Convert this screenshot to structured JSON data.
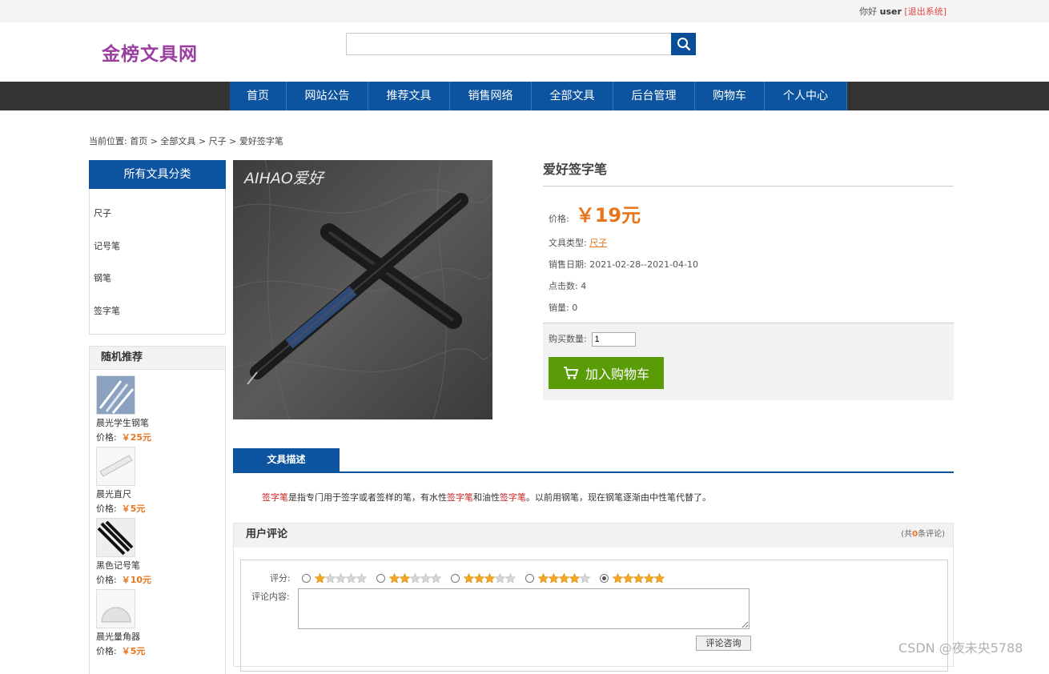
{
  "topbar": {
    "greeting": "你好",
    "username": "user",
    "logout": "[退出系统]"
  },
  "header": {
    "logo": "金榜文具网",
    "search_placeholder": ""
  },
  "nav": [
    "首页",
    "网站公告",
    "推荐文具",
    "销售网络",
    "全部文具",
    "后台管理",
    "购物车",
    "个人中心"
  ],
  "breadcrumb": "当前位置: 首页 > 全部文具 > 尺子 > 爱好签字笔",
  "sidebar": {
    "category_title": "所有文具分类",
    "categories": [
      "尺子",
      "记号笔",
      "钢笔",
      "签字笔"
    ],
    "recommend_title": "随机推荐",
    "recommendations": [
      {
        "name": "晨光学生钢笔",
        "price_label": "价格:",
        "price": "￥25元"
      },
      {
        "name": "晨光直尺",
        "price_label": "价格:",
        "price": "￥5元"
      },
      {
        "name": "黑色记号笔",
        "price_label": "价格:",
        "price": "￥10元"
      },
      {
        "name": "晨光量角器",
        "price_label": "价格:",
        "price": "￥5元"
      }
    ]
  },
  "product": {
    "image_brand": "AIHAO爱好",
    "title": "爱好签字笔",
    "price_label": "价格:",
    "price": "￥19元",
    "type_label": "文具类型:",
    "type": "尺子",
    "date_label": "销售日期:",
    "date": "2021-02-28--2021-04-10",
    "clicks_label": "点击数:",
    "clicks": "4",
    "sales_label": "销量:",
    "sales": "0",
    "qty_label": "购买数量:",
    "qty": "1",
    "cart_button": "加入购物车"
  },
  "description": {
    "tab": "文具描述",
    "parts": [
      "签字笔",
      "是指专门用于签字或者签样的笔，有水性",
      "签字笔",
      "和油性",
      "签字笔",
      "。以前用钢笔，现在钢笔逐渐由中性笔代替了。"
    ]
  },
  "reviews": {
    "title": "用户评论",
    "count_prefix": "(共",
    "count": "0",
    "count_suffix": "条评论)",
    "rating_label": "评分:",
    "content_label": "评论内容:",
    "submit": "评论咨询",
    "selected_rating": 5
  },
  "watermark": "CSDN @夜未央5788",
  "colors": {
    "nav_blue": "#0d54a0",
    "price_orange": "#e8741c",
    "cart_green": "#5a9c08",
    "logo_purple": "#9a3fa0"
  }
}
